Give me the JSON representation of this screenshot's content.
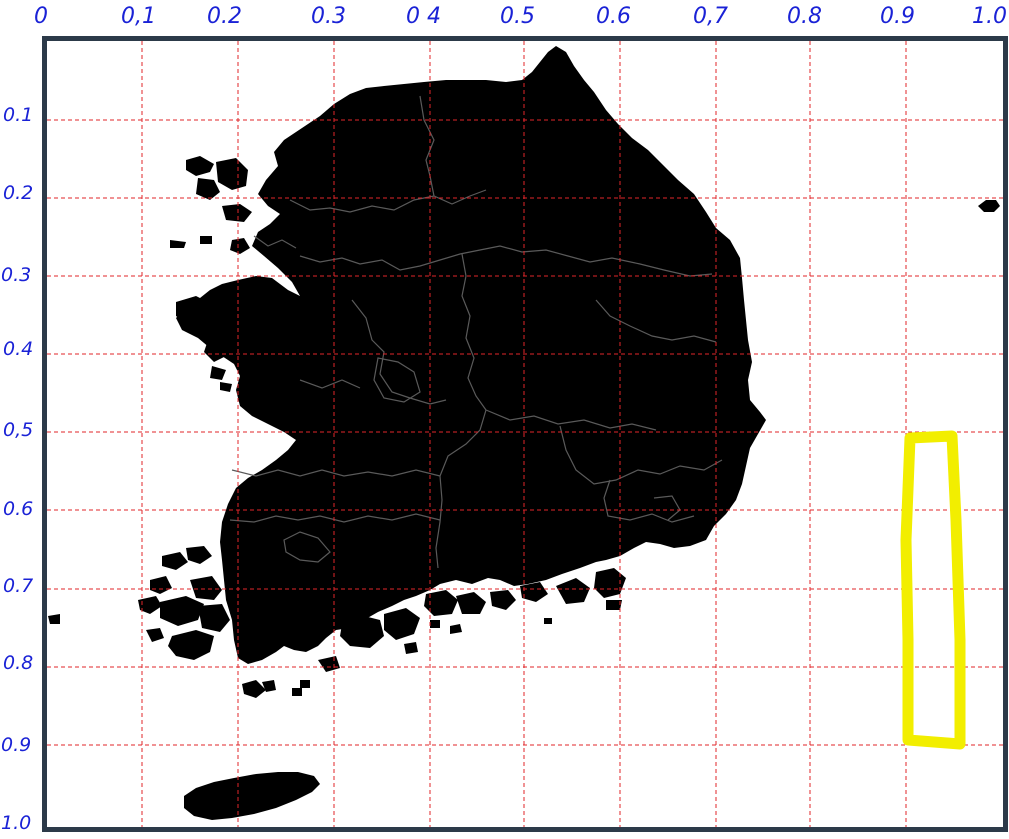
{
  "axis_labels": {
    "top": [
      "0",
      "0,1",
      "0.2",
      "0.3",
      "0 4",
      "0.5",
      "0.6",
      "0,7",
      "0.8",
      "0.9",
      "1.0"
    ],
    "left": [
      "0.1",
      "0.2",
      "0.3",
      "0.4",
      "0,5",
      "0.6",
      "0.7",
      "0.8",
      "0.9",
      "1.0"
    ]
  },
  "colors": {
    "grid": "#e0262a",
    "handwriting": "#1a22d6",
    "land": "#000000",
    "borders": "#5a5a5a",
    "highlight": "#f2ee00",
    "frame": "#2c3a49"
  },
  "map": {
    "region": "South Korea"
  }
}
